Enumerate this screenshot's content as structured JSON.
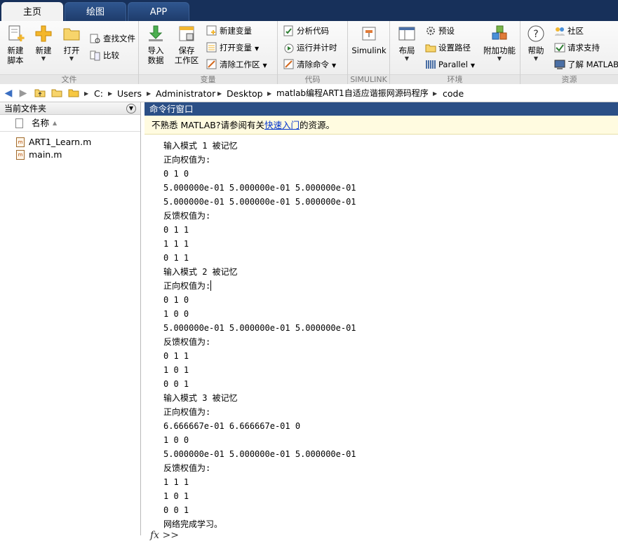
{
  "tabs": [
    {
      "label": "主页",
      "active": true
    },
    {
      "label": "绘图",
      "active": false
    },
    {
      "label": "APP",
      "active": false
    }
  ],
  "ribbon": {
    "file": {
      "group_label": "文件",
      "new_script": "新建\n脚本",
      "new": "新建",
      "open": "打开",
      "find_files": "查找文件",
      "compare": "比较"
    },
    "variable": {
      "group_label": "变量",
      "import": "导入\n数据",
      "save_ws": "保存\n工作区",
      "new_var": "新建变量",
      "open_var": "打开变量",
      "clear_ws": "清除工作区"
    },
    "code": {
      "group_label": "代码",
      "analyze": "分析代码",
      "run_time": "运行并计时",
      "clear_cmd": "清除命令"
    },
    "simulink": {
      "group_label": "SIMULINK",
      "simulink": "Simulink"
    },
    "env": {
      "group_label": "环境",
      "layout": "布局",
      "prefs": "预设",
      "set_path": "设置路径",
      "parallel": "Parallel",
      "addons": "附加功能"
    },
    "resources": {
      "group_label": "资源",
      "help": "帮助",
      "community": "社区",
      "support": "请求支持",
      "learn": "了解 MATLAB"
    }
  },
  "address": {
    "crumbs": [
      "C:",
      "Users",
      "Administrator",
      "Desktop",
      "matlab编程ART1自适应谐振网源码程序",
      "code"
    ]
  },
  "left_panel": {
    "title": "当前文件夹",
    "col_name": "名称",
    "files": [
      "ART1_Learn.m",
      "main.m"
    ]
  },
  "command_window": {
    "title": "命令行窗口",
    "notice_prefix": "不熟悉 MATLAB?请参阅有关",
    "notice_link": "快速入门",
    "notice_suffix": "的资源。",
    "lines": [
      "输入模式 1 被记忆",
      "正向权值为:",
      "0 1 0",
      "5.000000e-01 5.000000e-01 5.000000e-01",
      "5.000000e-01 5.000000e-01 5.000000e-01",
      "反馈权值为:",
      "0 1 1",
      "1 1 1",
      "0 1 1",
      "输入模式 2 被记忆",
      "正向权值为:",
      "0 1 0",
      "1 0 0",
      "5.000000e-01 5.000000e-01 5.000000e-01",
      "反馈权值为:",
      "0 1 1",
      "1 0 1",
      "0 0 1",
      "输入模式 3 被记忆",
      "正向权值为:",
      "6.666667e-01 6.666667e-01 0",
      "1 0 0",
      "5.000000e-01 5.000000e-01 5.000000e-01",
      "反馈权值为:",
      "1 1 1",
      "1 0 1",
      "0 0 1",
      "网络完成学习。"
    ],
    "prompt": "fx >>"
  },
  "colors": {
    "titlebar": "#17305a",
    "panel_header": "#2b4f86",
    "notice_bg": "#fffbe0",
    "link": "#0033cc"
  }
}
